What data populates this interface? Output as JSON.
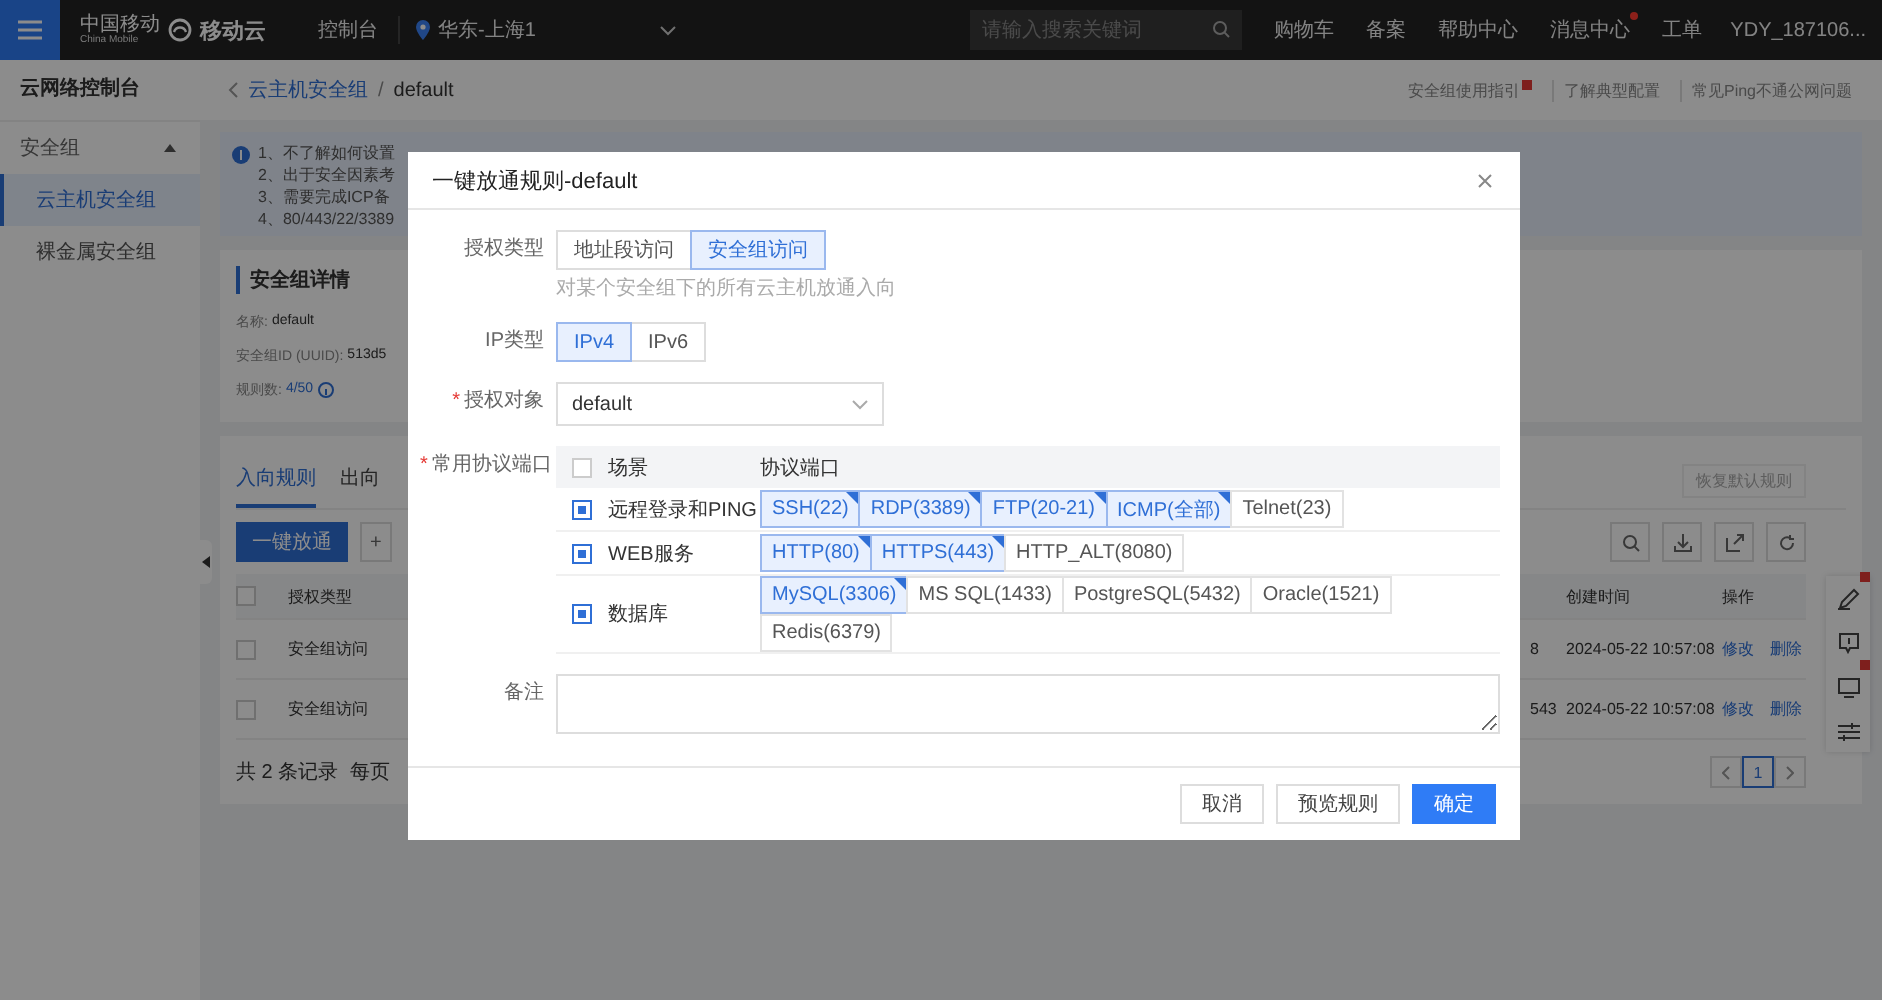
{
  "top_bar": {
    "operator": "中国移动",
    "operator_en": "China Mobile",
    "brand": "移动云",
    "console": "控制台",
    "region": "华东-上海1",
    "search": {
      "placeholder": "请输入搜索关键词"
    },
    "links": [
      {
        "label": "购物车",
        "badge": false
      },
      {
        "label": "备案",
        "badge": false
      },
      {
        "label": "帮助中心",
        "badge": false
      },
      {
        "label": "消息中心",
        "badge": true
      },
      {
        "label": "工单",
        "badge": false
      }
    ],
    "user": "YDY_187106..."
  },
  "sidebar": {
    "title": "云网络控制台",
    "groups": [
      {
        "label": "安全组",
        "expanded": true,
        "children": [
          {
            "label": "云主机安全组",
            "selected": true
          },
          {
            "label": "裸金属安全组",
            "selected": false
          }
        ]
      }
    ]
  },
  "breadcrumb": {
    "items": [
      "云主机安全组",
      "default"
    ],
    "separator": "/"
  },
  "help_links": [
    {
      "label": "安全组使用指引",
      "badge": true
    },
    {
      "label": "了解典型配置",
      "badge": false
    },
    {
      "label": "常见Ping不通公网问题",
      "badge": false
    }
  ],
  "notice": {
    "lines": [
      "1、不了解如何设置",
      "2、出于安全因素考",
      "3、需要完成ICP备",
      "4、80/443/22/3389"
    ]
  },
  "details": {
    "title": "安全组详情",
    "fields": [
      {
        "label": "名称:",
        "value": "default",
        "info": false
      },
      {
        "label": "安全组ID (UUID):",
        "value": "513d5",
        "info": false
      },
      {
        "label": "规则数:",
        "value": "4/50",
        "info": true
      }
    ]
  },
  "rules": {
    "tabs": [
      {
        "label": "入向规则",
        "selected": true
      },
      {
        "label": "出向",
        "selected": false
      }
    ],
    "restore": "恢复默认规则",
    "primary_button": "一键放通",
    "add_button": "+",
    "table": {
      "all_checked": false,
      "columns": [
        "授权类型",
        "创建时间",
        "操作"
      ],
      "rows": [
        {
          "checked": false,
          "type": "安全组访问",
          "column_3": "8",
          "created": "2024-05-22 10:57:08",
          "actions": [
            "修改",
            "删除"
          ]
        },
        {
          "checked": false,
          "type": "安全组访问",
          "column_3": "543",
          "created": "2024-05-22 10:57:08",
          "actions": [
            "修改",
            "删除"
          ]
        }
      ]
    },
    "total": "共 2 条记录",
    "page_size": "每页",
    "page": "1"
  },
  "modal": {
    "title": "一键放通规则-default",
    "auth_type": {
      "label": "授权类型",
      "options": [
        {
          "label": "地址段访问",
          "selected": false
        },
        {
          "label": "安全组访问",
          "selected": true
        }
      ],
      "hint": "对某个安全组下的所有云主机放通入向"
    },
    "ip_type": {
      "label": "IP类型",
      "options": [
        {
          "label": "IPv4",
          "selected": true
        },
        {
          "label": "IPv6",
          "selected": false
        }
      ]
    },
    "target": {
      "label": "授权对象",
      "marker": "*",
      "value": "default"
    },
    "ports": {
      "label": "常用协议端口",
      "marker": "*",
      "columns": [
        "场景",
        "协议端口"
      ],
      "all_checked": false,
      "rows": [
        {
          "scene": "远程登录和PING",
          "checked": true,
          "ports": [
            {
              "label": "SSH(22)",
              "selected": true
            },
            {
              "label": "RDP(3389)",
              "selected": true
            },
            {
              "label": "FTP(20-21)",
              "selected": true
            },
            {
              "label": "ICMP(全部)",
              "selected": true
            },
            {
              "label": "Telnet(23)",
              "selected": false
            }
          ]
        },
        {
          "scene": "WEB服务",
          "checked": true,
          "ports": [
            {
              "label": "HTTP(80)",
              "selected": true
            },
            {
              "label": "HTTPS(443)",
              "selected": true
            },
            {
              "label": "HTTP_ALT(8080)",
              "selected": false
            }
          ]
        },
        {
          "scene": "数据库",
          "checked": true,
          "ports": [
            {
              "label": "MySQL(3306)",
              "selected": true
            },
            {
              "label": "MS SQL(1433)",
              "selected": false
            },
            {
              "label": "PostgreSQL(5432)",
              "selected": false
            },
            {
              "label": "Oracle(1521)",
              "selected": false
            },
            {
              "label": "Redis(6379)",
              "selected": false
            }
          ]
        }
      ]
    },
    "remark": {
      "label": "备注"
    },
    "buttons": [
      {
        "label": "取消",
        "kind": "default"
      },
      {
        "label": "预览规则",
        "kind": "default"
      },
      {
        "label": "确定",
        "kind": "primary"
      }
    ]
  }
}
